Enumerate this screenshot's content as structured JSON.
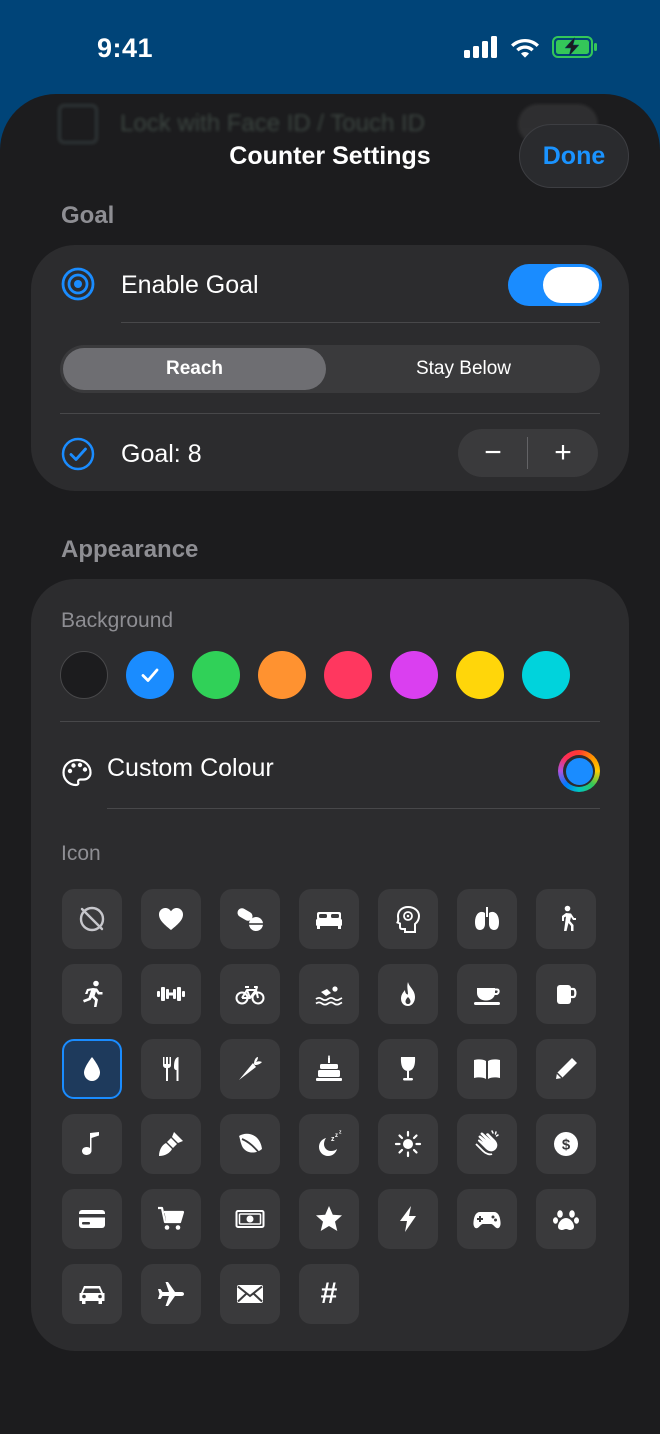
{
  "status": {
    "time": "9:41"
  },
  "behind": {
    "text": "Lock with Face ID / Touch ID"
  },
  "header": {
    "title": "Counter Settings",
    "done_label": "Done"
  },
  "goal": {
    "section_title": "Goal",
    "enable_label": "Enable Goal",
    "enabled": true,
    "modes": [
      "Reach",
      "Stay Below"
    ],
    "selected_mode": "Reach",
    "goal_label": "Goal: 8",
    "stepper_minus": "−",
    "stepper_plus": "+"
  },
  "appearance": {
    "section_title": "Appearance",
    "background_label": "Background",
    "background_colors": [
      "#1c1c1e",
      "#1a8cff",
      "#30d158",
      "#ff9230",
      "#ff375f",
      "#da3ff0",
      "#ffd60a",
      "#00d3dc"
    ],
    "selected_background": "#1a8cff",
    "custom_colour_label": "Custom Colour",
    "icon_label": "Icon",
    "icons": [
      "no-icon",
      "heart-icon",
      "pills-icon",
      "bed-icon",
      "brain-icon",
      "lungs-icon",
      "walking-icon",
      "running-icon",
      "dumbbell-icon",
      "bicycle-icon",
      "swimming-icon",
      "flame-icon",
      "teacup-icon",
      "mug-icon",
      "water-drop-icon",
      "fork-knife-icon",
      "carrot-icon",
      "cake-icon",
      "wine-glass-icon",
      "book-icon",
      "pencil-icon",
      "music-note-icon",
      "paintbrush-icon",
      "leaf-icon",
      "sleep-moon-icon",
      "sun-icon",
      "clapping-hands-icon",
      "dollar-coin-icon",
      "credit-card-icon",
      "cart-icon",
      "banknote-icon",
      "star-icon",
      "bolt-icon",
      "gamepad-icon",
      "paw-icon",
      "car-icon",
      "airplane-icon",
      "envelope-icon",
      "hash-icon"
    ],
    "selected_icon": "water-drop-icon",
    "hash_glyph": "#"
  }
}
